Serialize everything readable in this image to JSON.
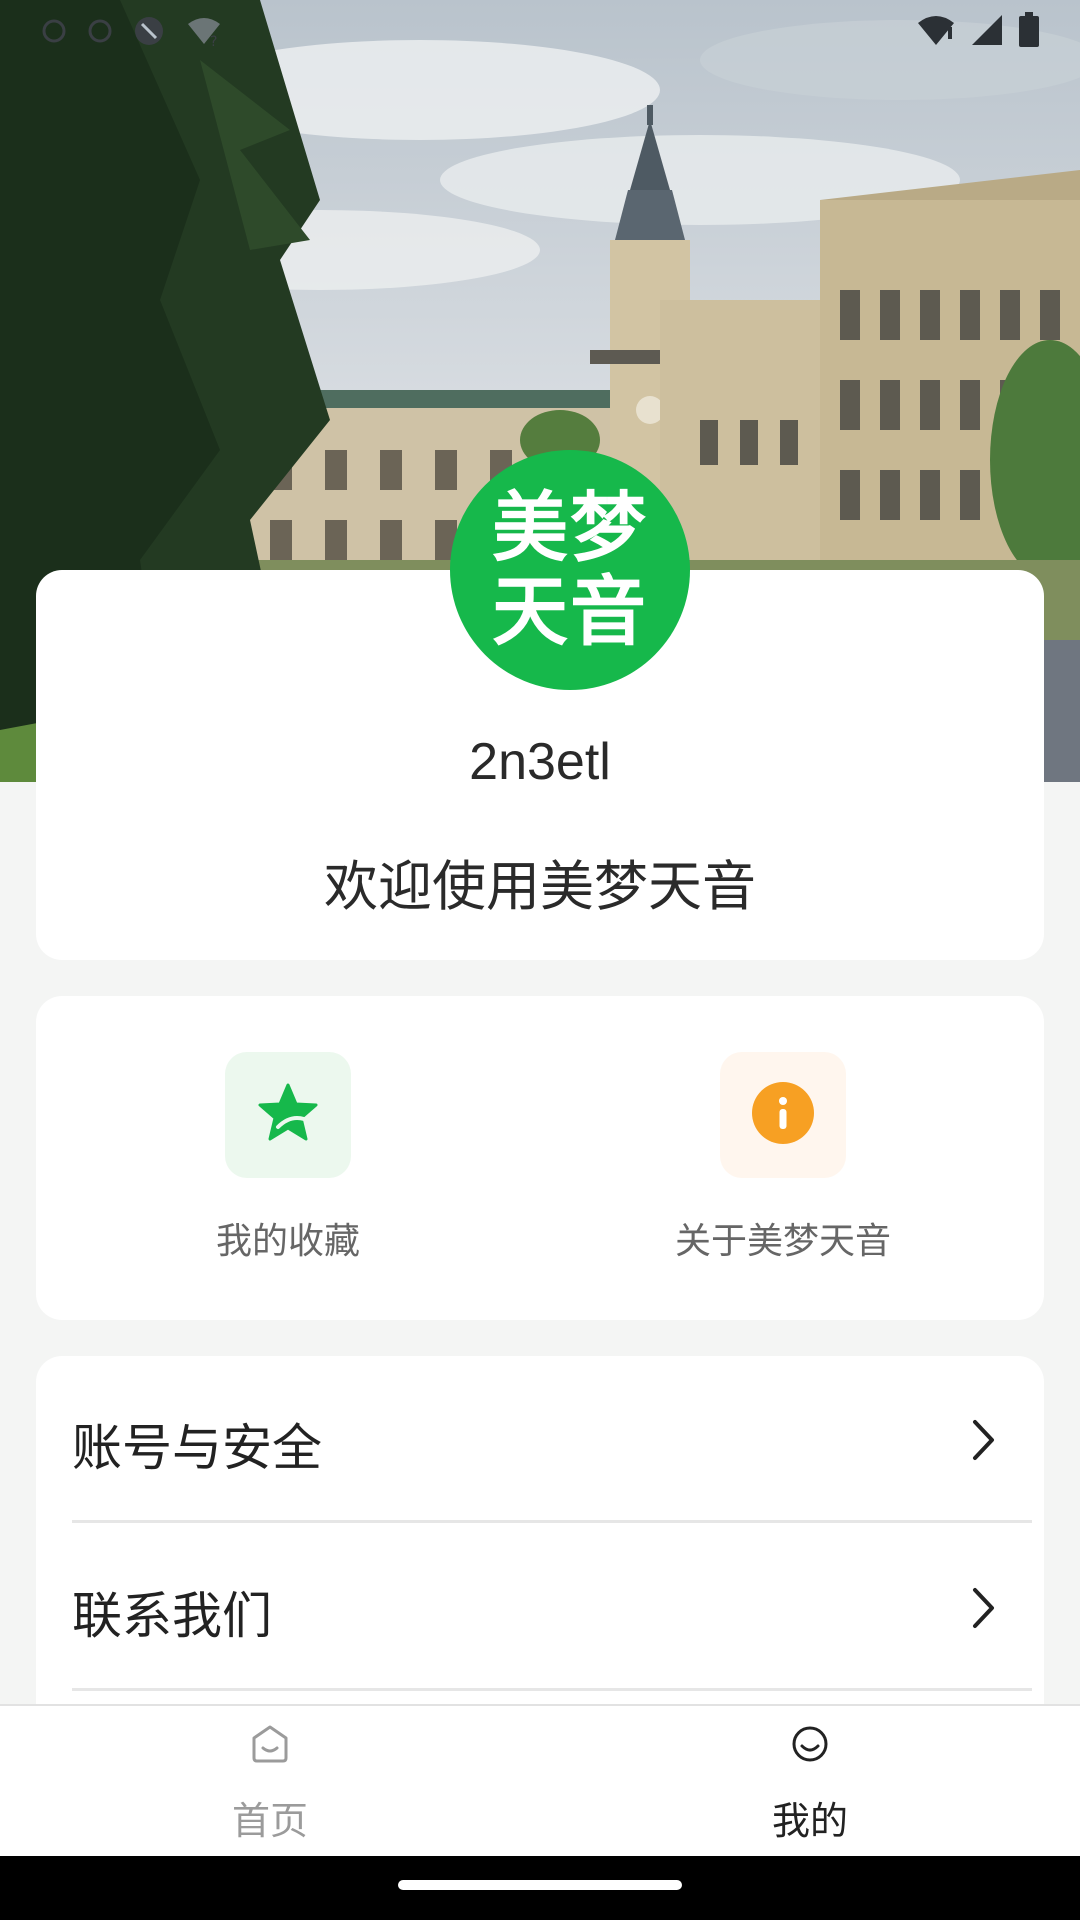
{
  "status_bar": {
    "left_icons": [
      "notification-icon",
      "notification-icon",
      "vpn-icon",
      "wifi-unknown-icon"
    ],
    "right_icons": [
      "wifi-icon",
      "signal-icon",
      "battery-icon"
    ]
  },
  "profile": {
    "avatar_text_line1": "美梦",
    "avatar_text_line2": "天音",
    "avatar_color": "#16b84b",
    "username": "2n3etl",
    "welcome": "欢迎使用美梦天音"
  },
  "quick_actions": [
    {
      "label": "我的收藏",
      "icon": "star-icon",
      "color": "#16b84b"
    },
    {
      "label": "关于美梦天音",
      "icon": "info-icon",
      "color": "#f7a023"
    }
  ],
  "settings_list": [
    {
      "label": "账号与安全",
      "icon": "chevron-right-icon"
    },
    {
      "label": "联系我们",
      "icon": "chevron-right-icon"
    }
  ],
  "bottom_nav": {
    "items": [
      {
        "label": "首页",
        "icon": "home-face-icon",
        "active": false
      },
      {
        "label": "我的",
        "icon": "smile-face-icon",
        "active": true
      }
    ]
  }
}
